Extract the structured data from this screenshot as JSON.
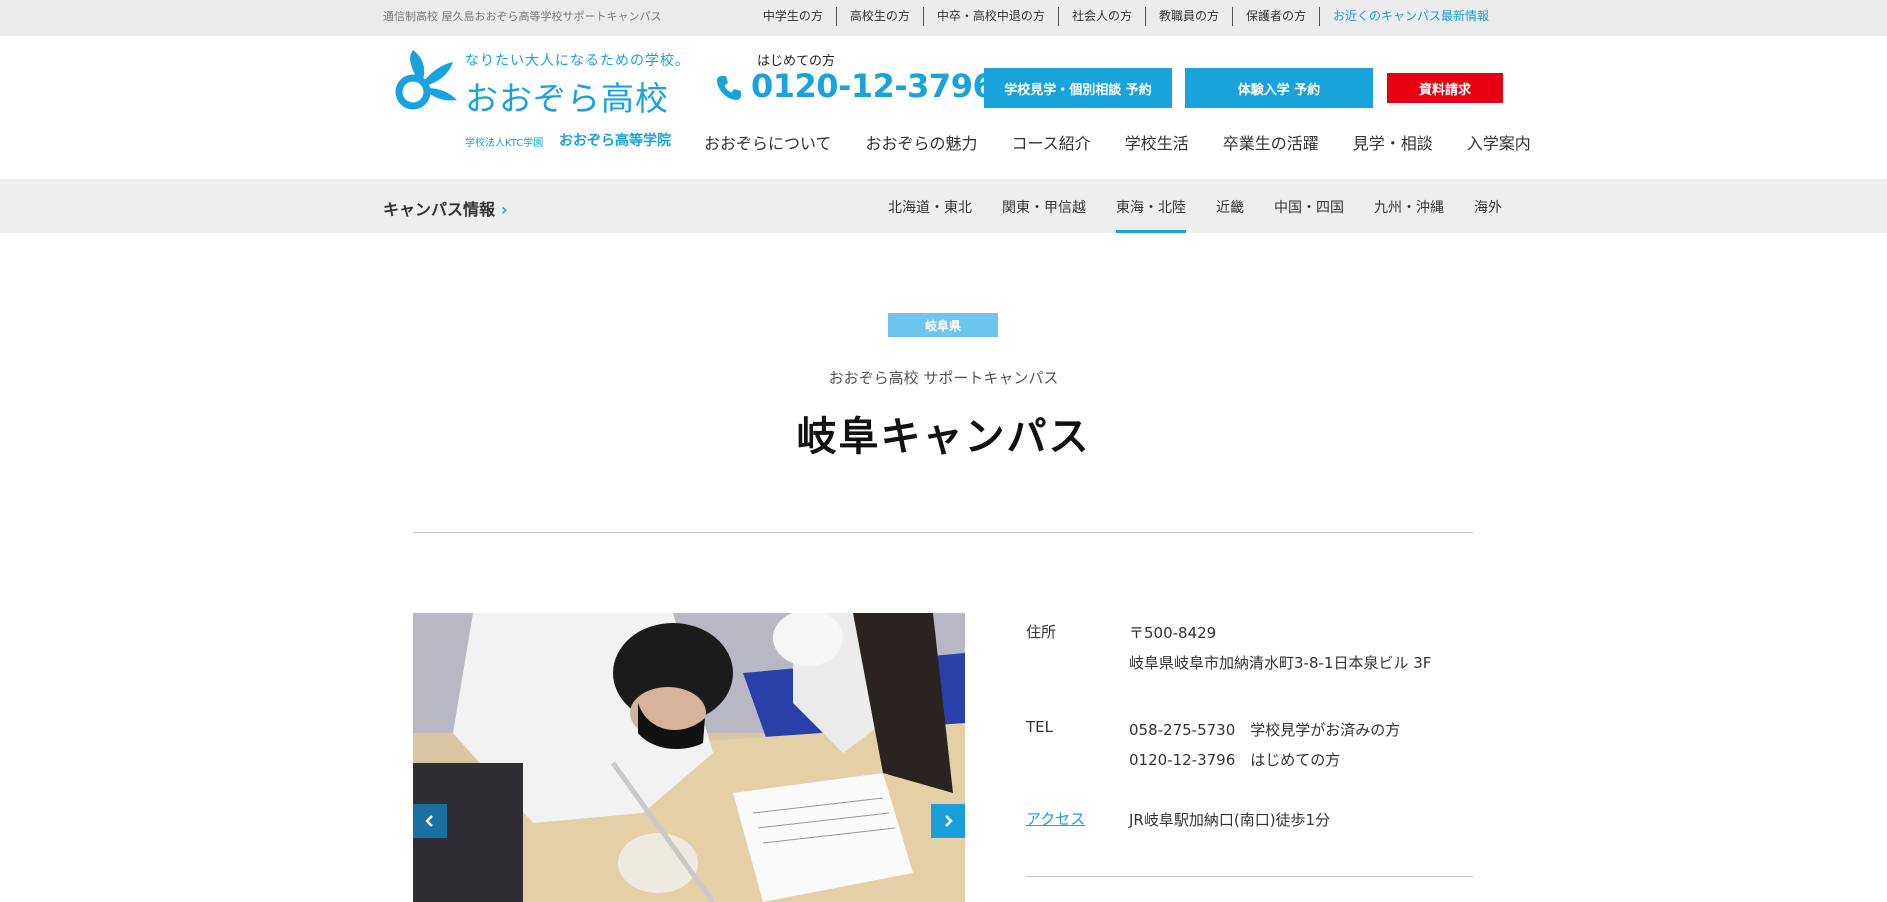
{
  "topbar": {
    "tagline": "通信制高校 屋久島おおぞら高等学校サポートキャンパス",
    "links": [
      "中学生の方",
      "高校生の方",
      "中卒・高校中退の方",
      "社会人の方",
      "教職員の方",
      "保護者の方",
      "お近くのキャンパス最新情報"
    ]
  },
  "logo": {
    "tagline": "なりたい大人になるための学校。",
    "name": "おおぞら高校",
    "sub_corp": "学校法人KTC学園",
    "sub_school": "おおぞら高等学院"
  },
  "phone": {
    "label": "はじめての方",
    "number": "0120-12-3796"
  },
  "buttons": {
    "visit": "学校見学・個別相談 予約",
    "trial": "体験入学 予約",
    "docs": "資料請求"
  },
  "gnav": [
    "おおぞらについて",
    "おおぞらの魅力",
    "コース紹介",
    "学校生活",
    "卒業生の活躍",
    "見学・相談",
    "入学案内"
  ],
  "campusbar": {
    "title": "キャンパス情報",
    "regions": [
      "北海道・東北",
      "関東・甲信越",
      "東海・北陸",
      "近畿",
      "中国・四国",
      "九州・沖縄",
      "海外"
    ],
    "active_region": "東海・北陸"
  },
  "page": {
    "prefecture": "岐阜県",
    "subtitle": "おおぞら高校 サポートキャンパス",
    "title": "岐阜キャンパス"
  },
  "info": {
    "address_label": "住所",
    "postal": "〒500-8429",
    "address": "岐阜県岐阜市加納清水町3-8-1日本泉ビル 3F",
    "tel_label": "TEL",
    "tel1": "058-275-5730　学校見学がお済みの方",
    "tel2": "0120-12-3796　はじめての方",
    "access_label": "アクセス",
    "access": "JR岐阜駅加納口(南口)徒歩1分"
  },
  "colors": {
    "brand_blue": "#19a3dc",
    "red": "#e60012",
    "badge_blue": "#6ec5ed"
  }
}
